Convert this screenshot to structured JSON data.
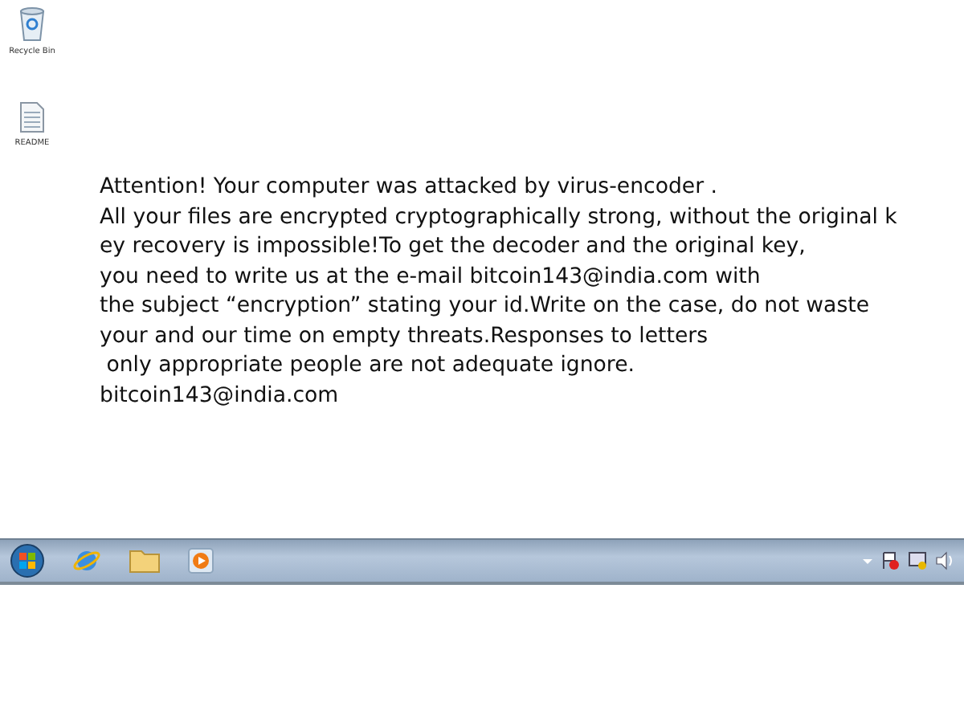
{
  "desktop_icons": [
    {
      "kind": "recycle-bin",
      "label": "Recycle Bin"
    },
    {
      "kind": "document",
      "label": "README"
    }
  ],
  "note": {
    "lines": [
      "Attention! Your computer was attacked by virus-encoder .",
      "All your files are encrypted cryptographically strong, without the original k",
      "ey recovery is impossible!To get the decoder and the original key,",
      "you need to write us at the e-mail bitcoin143@india.com with",
      "the subject “encryption” stating your id.Write on the case, do not waste",
      "your and our time on empty threats.Responses to letters",
      " only appropriate people are not adequate ignore.",
      "bitcoin143@india.com"
    ]
  },
  "taskbar": {
    "pinned": [
      {
        "kind": "browser"
      },
      {
        "kind": "folder"
      },
      {
        "kind": "media"
      }
    ]
  }
}
